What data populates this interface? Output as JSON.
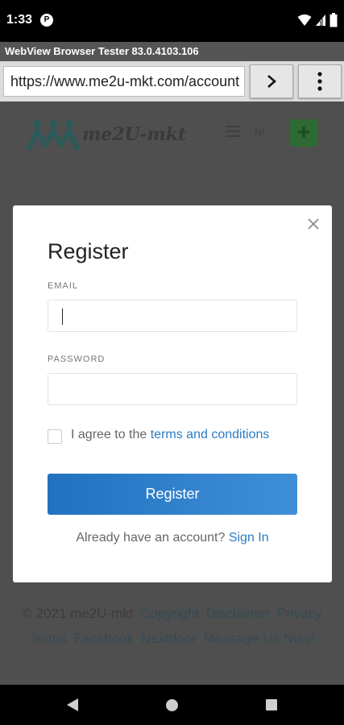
{
  "status_bar": {
    "time": "1:33",
    "app_icon_glyph": "P"
  },
  "browser": {
    "title": "WebView Browser Tester 83.0.4103.106",
    "url": "https://www.me2u-mkt.com/account",
    "go_icon": "chevron-right-icon",
    "menu_icon": "more-vertical-icon"
  },
  "site": {
    "logo_text": "me2U-mkt",
    "lang": "NI"
  },
  "modal": {
    "title": "Register",
    "email_label": "EMAIL",
    "email_value": "",
    "password_label": "PASSWORD",
    "password_value": "",
    "agree_prefix": "I agree to the ",
    "agree_link": "terms and conditions",
    "register_button": "Register",
    "signin_prefix": "Already have an account? ",
    "signin_link": "Sign In"
  },
  "footer": {
    "copyright": "© 2021 me2U-mkt",
    "links": [
      "Copyright",
      "Disclaimer",
      "Privacy",
      "Terms",
      "Facebook",
      "Nextdoor",
      "Message Us Now!"
    ]
  },
  "colors": {
    "accent": "#2d7bc4",
    "register_gradient_start": "#2271c0",
    "register_gradient_end": "#3f8fd8",
    "overlay": "#4f4f4f"
  }
}
